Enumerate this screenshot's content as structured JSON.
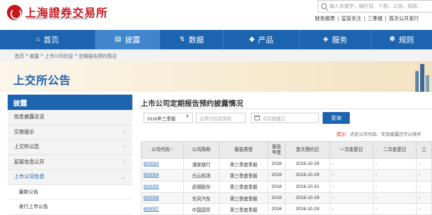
{
  "header": {
    "logo_cn": "上海證券交易所",
    "logo_en": "SHANGHAI STOCK EXCHANGE",
    "search_placeholder": "输入关键字，搜栏目、个股、公告、规则...",
    "quick_links": [
      "财务报表",
      "监管关注",
      "三季报",
      "首次公开发行"
    ]
  },
  "nav": {
    "items": [
      {
        "label": "首页",
        "icon": "home-icon",
        "glyph": "⌂"
      },
      {
        "label": "披露",
        "icon": "document-icon",
        "glyph": "▤"
      },
      {
        "label": "数据",
        "icon": "data-icon",
        "glyph": "↯"
      },
      {
        "label": "产品",
        "icon": "product-icon",
        "glyph": "◆"
      },
      {
        "label": "服务",
        "icon": "service-icon",
        "glyph": "◈"
      },
      {
        "label": "规则",
        "icon": "rules-icon",
        "glyph": "✽"
      }
    ],
    "active_index": 1
  },
  "breadcrumb": [
    "首页",
    "披露",
    "上市公司信息",
    "定期报告预约情况"
  ],
  "banner": {
    "title": "上交所公告"
  },
  "sidebar": {
    "title": "披露",
    "items": [
      {
        "label": "信息披露总览",
        "arrow": ""
      },
      {
        "label": "交易提示",
        "arrow": "›"
      },
      {
        "label": "上交所公告",
        "arrow": "›"
      },
      {
        "label": "监管信息公开",
        "arrow": "›"
      },
      {
        "label": "上市公司信息",
        "arrow": "⌄"
      }
    ],
    "sub_items": [
      "最新公告",
      "发行上市公告"
    ]
  },
  "content": {
    "title": "上市公司定期报告预约披露情况",
    "filters": {
      "quarter": "2016年三季报",
      "code_placeholder": "证券代码或简称",
      "date_placeholder": "实际披露日"
    },
    "query_label": "查询",
    "tip_label": "提示：",
    "tip_text": "点击公司代码、实际披露日可以排序"
  },
  "table": {
    "columns": [
      "公司代码",
      "公司简称",
      "报告类型",
      "报告\n年度",
      "首次预约日",
      "一次变更日",
      "二次变更日",
      "三"
    ],
    "rows": [
      [
        "600000",
        "浦发银行",
        "第三季度季报",
        "2016",
        "2016-10-29",
        "-",
        "-",
        "-"
      ],
      [
        "600004",
        "白云机场",
        "第三季度季报",
        "2016",
        "2016-10-29",
        "-",
        "-",
        "-"
      ],
      [
        "600005",
        "武钢股份",
        "第三季度季报",
        "2016",
        "2016-10-31",
        "-",
        "-",
        "-"
      ],
      [
        "600006",
        "东风汽车",
        "第三季度季报",
        "2016",
        "2016-10-29",
        "-",
        "-",
        "-"
      ],
      [
        "600007",
        "中国国贸",
        "第三季度季报",
        "2016",
        "2016-10-29",
        "-",
        "-",
        "-"
      ]
    ]
  },
  "colors": {
    "brand_blue": "#1d64b0",
    "logo_red": "#c8161d",
    "tip_red": "#d9261c"
  }
}
